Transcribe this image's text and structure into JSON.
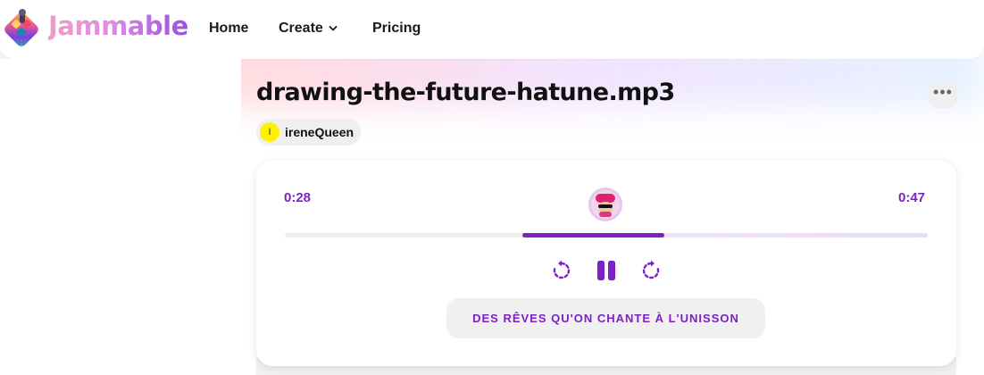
{
  "header": {
    "brand": "Jammable",
    "nav": {
      "home": "Home",
      "create": "Create",
      "pricing": "Pricing"
    }
  },
  "track": {
    "title": "drawing-the-future-hatune.mp3",
    "more_label": "•••",
    "user": {
      "initial": "I",
      "name": "ireneQueen"
    }
  },
  "player": {
    "time_current": "0:28",
    "time_total": "0:47",
    "progress": {
      "start_fraction": 0.37,
      "end_fraction": 0.59
    },
    "lyric": "DES RÊVES QU'ON CHANTE À L'UNISSON"
  },
  "colors": {
    "accent": "#7c22c4",
    "avatar_yellow": "#fff200"
  },
  "icons": [
    "jammable-logo-icon",
    "chevron-down-icon",
    "more-dots-icon",
    "rewind-icon",
    "pause-icon",
    "forward-icon"
  ]
}
